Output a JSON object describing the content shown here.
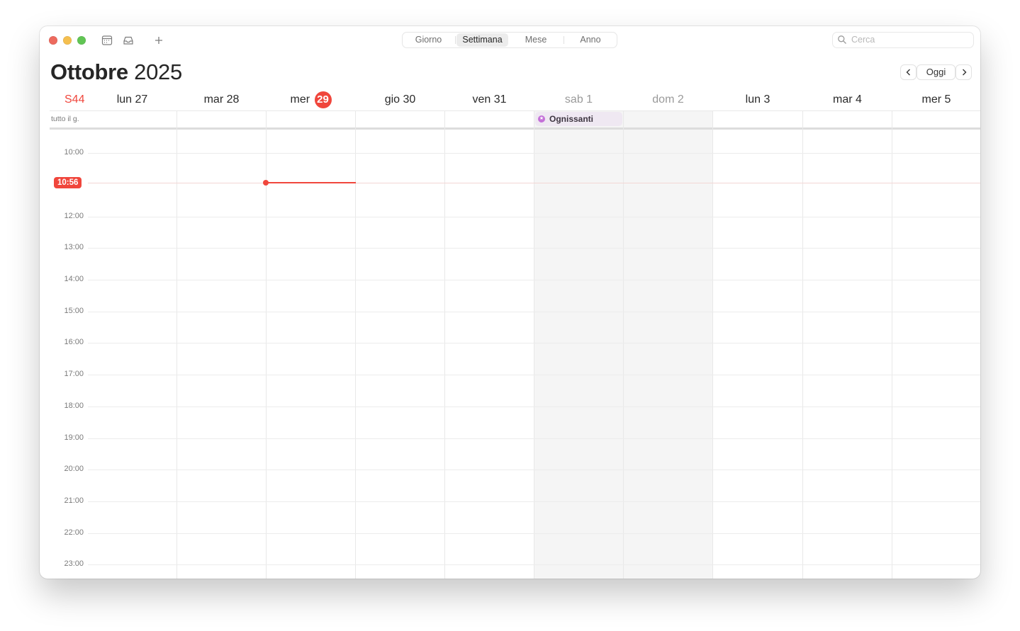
{
  "toolbar": {
    "views": [
      {
        "label": "Giorno",
        "active": false
      },
      {
        "label": "Settimana",
        "active": true
      },
      {
        "label": "Mese",
        "active": false
      },
      {
        "label": "Anno",
        "active": false
      }
    ],
    "search_placeholder": "Cerca",
    "icons": [
      "calendar-list-icon",
      "inbox-icon",
      "plus-icon"
    ]
  },
  "header": {
    "month": "Ottobre",
    "year": "2025",
    "today_label": "Oggi"
  },
  "week": {
    "number_label": "S44",
    "days": [
      {
        "label": "lun 27",
        "weekend": false
      },
      {
        "label": "mar 28",
        "weekend": false
      },
      {
        "label": "mer",
        "date": "29",
        "today": true,
        "weekend": false
      },
      {
        "label": "gio 30",
        "weekend": false
      },
      {
        "label": "ven 31",
        "weekend": false
      },
      {
        "label": "sab 1",
        "weekend": true
      },
      {
        "label": "dom 2",
        "weekend": true
      },
      {
        "label": "lun 3",
        "weekend": false
      },
      {
        "label": "mar 4",
        "weekend": false
      },
      {
        "label": "mer 5",
        "weekend": false
      }
    ]
  },
  "all_day": {
    "label": "tutto il g.",
    "events": [
      {
        "title": "Ognissanti",
        "day": "sab 1",
        "color": "#c470d8"
      }
    ]
  },
  "timeline": {
    "hours": [
      "10:00",
      "12:00",
      "13:00",
      "14:00",
      "15:00",
      "16:00",
      "17:00",
      "18:00",
      "19:00",
      "20:00",
      "21:00",
      "22:00",
      "23:00"
    ],
    "current_time": "10:56"
  },
  "colors": {
    "accent_red": "#f0463c",
    "holiday_purple": "#c470d8",
    "weekend_bg": "#f5f5f5"
  }
}
